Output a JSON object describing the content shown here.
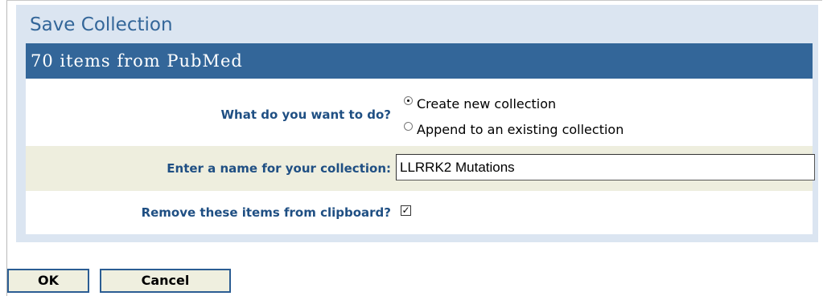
{
  "dialog": {
    "title": "Save Collection",
    "header": "70 items from PubMed"
  },
  "action_row": {
    "label": "What do you want to do?",
    "options": [
      {
        "label": "Create new collection",
        "selected": true
      },
      {
        "label": "Append to an existing collection",
        "selected": false
      }
    ]
  },
  "name_row": {
    "label": "Enter a name for your collection:",
    "value": "LLRRK2 Mutations"
  },
  "remove_row": {
    "label": "Remove these items from clipboard?",
    "checked": true,
    "check_glyph": "✓"
  },
  "buttons": {
    "ok": "OK",
    "cancel": "Cancel"
  },
  "colors": {
    "accent": "#336699",
    "panel_bg": "#dbe5f1",
    "row_alt": "#eeeede",
    "label": "#1f4f83"
  }
}
